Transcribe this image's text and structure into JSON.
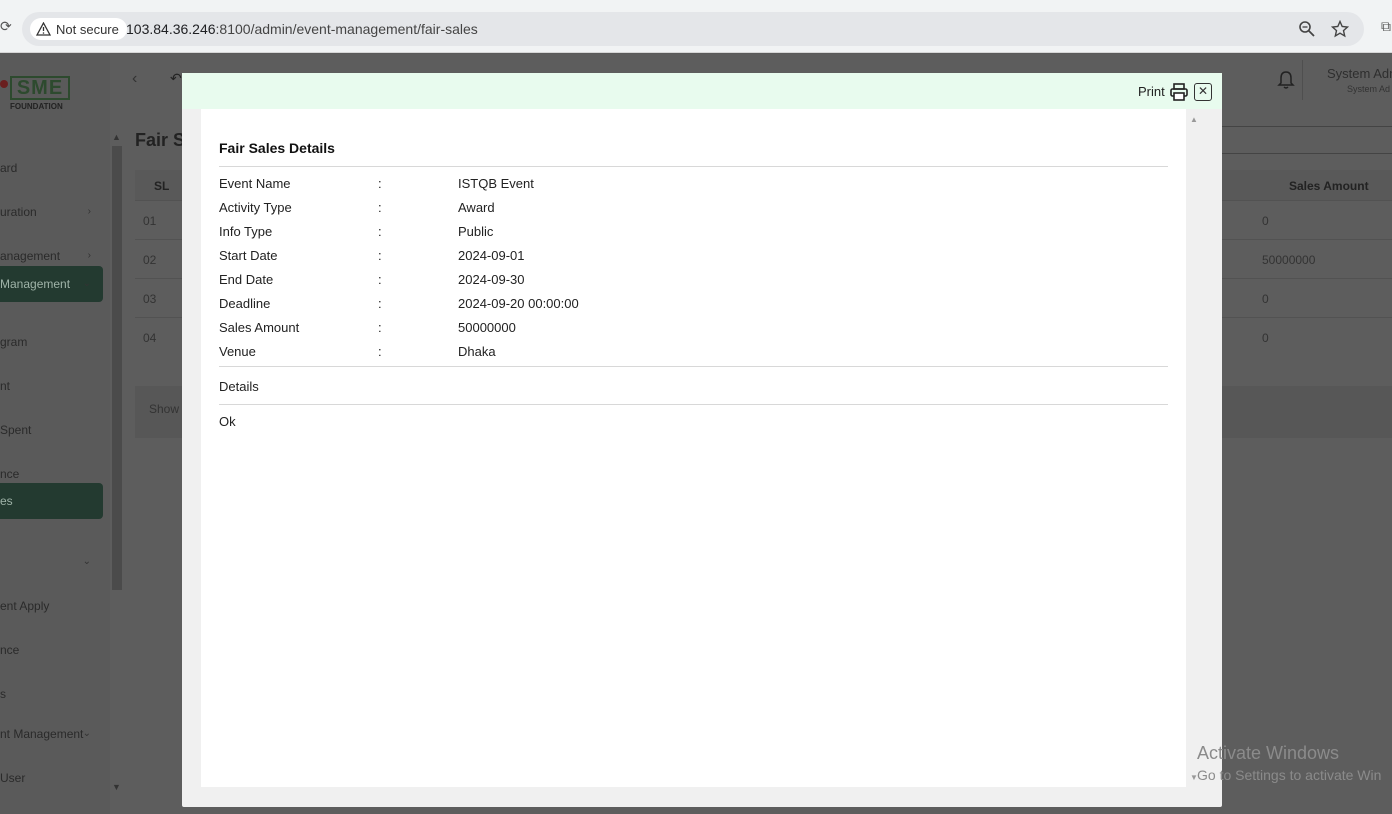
{
  "browser": {
    "security_label": "Not secure",
    "url_host": "103.84.36.246",
    "url_path": ":8100/admin/event-management/fair-sales"
  },
  "sidebar": {
    "items": [
      {
        "label": "ard",
        "caret": ""
      },
      {
        "label": "uration",
        "caret": "›"
      },
      {
        "label": "anagement",
        "caret": "›"
      },
      {
        "label": "Management",
        "caret": "⌄"
      },
      {
        "label": "gram",
        "caret": ""
      },
      {
        "label": "nt",
        "caret": ""
      },
      {
        "label": "Spent",
        "caret": ""
      },
      {
        "label": "nce",
        "caret": ""
      },
      {
        "label": "es",
        "caret": ""
      },
      {
        "label": "",
        "caret": "⌄"
      },
      {
        "label": "ent Apply",
        "caret": ""
      },
      {
        "label": "nce",
        "caret": ""
      },
      {
        "label": "s",
        "caret": ""
      },
      {
        "label": "nt Management",
        "caret": "⌄"
      },
      {
        "label": "User",
        "caret": ""
      }
    ]
  },
  "header": {
    "user_name": "System Adm",
    "user_role": "System Ad"
  },
  "page": {
    "title": "Fair S",
    "table_headers": {
      "sl": "SL",
      "sales_amount": "Sales Amount"
    },
    "rows": [
      {
        "sl": "01",
        "amount": "0"
      },
      {
        "sl": "02",
        "amount": "50000000"
      },
      {
        "sl": "03",
        "amount": "0"
      },
      {
        "sl": "04",
        "amount": "0"
      }
    ],
    "show_label": "Show"
  },
  "modal": {
    "print_label": "Print",
    "title": "Fair Sales Details",
    "fields": [
      {
        "label": "Event Name",
        "colon": ":",
        "value": "ISTQB Event"
      },
      {
        "label": "Activity Type",
        "colon": ":",
        "value": "Award"
      },
      {
        "label": "Info Type",
        "colon": ":",
        "value": "Public"
      },
      {
        "label": "Start Date",
        "colon": ":",
        "value": "2024-09-01"
      },
      {
        "label": "End Date",
        "colon": ":",
        "value": "2024-09-30"
      },
      {
        "label": "Deadline",
        "colon": ":",
        "value": "2024-09-20 00:00:00"
      },
      {
        "label": "Sales Amount",
        "colon": ":",
        "value": "50000000"
      },
      {
        "label": "Venue",
        "colon": ":",
        "value": "Dhaka"
      }
    ],
    "details_label": "Details",
    "ok_label": "Ok"
  },
  "watermark": {
    "line1": "Activate Windows",
    "line2": "Go to Settings to activate Win"
  },
  "colors": {
    "modal_header": "#e8fbee",
    "sidebar_active": "#233a30",
    "overlay": "#5d5d5d"
  }
}
